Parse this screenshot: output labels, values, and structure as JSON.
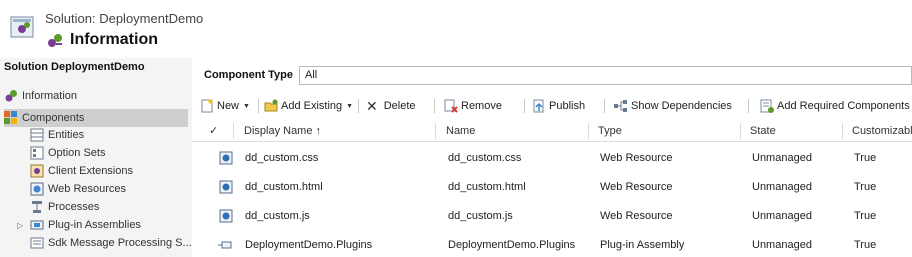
{
  "header": {
    "solution_label": "Solution: DeploymentDemo",
    "page_title": "Information"
  },
  "nav": {
    "title": "Solution DeploymentDemo",
    "items": [
      {
        "label": "Information",
        "icon": "information-icon"
      },
      {
        "label": "Components",
        "icon": "components-icon",
        "selected": true
      },
      {
        "label": "Entities",
        "icon": "entities-icon"
      },
      {
        "label": "Option Sets",
        "icon": "option-sets-icon"
      },
      {
        "label": "Client Extensions",
        "icon": "client-extensions-icon"
      },
      {
        "label": "Web Resources",
        "icon": "web-resources-icon"
      },
      {
        "label": "Processes",
        "icon": "processes-icon"
      },
      {
        "label": "Plug-in Assemblies",
        "icon": "plugin-assemblies-icon",
        "expander": "▷"
      },
      {
        "label": "Sdk Message Processing S...",
        "icon": "sdk-message-icon"
      }
    ]
  },
  "filter": {
    "label": "Component Type",
    "value": "All"
  },
  "toolbar": {
    "new": "New",
    "add_existing": "Add Existing",
    "delete": "Delete",
    "remove": "Remove",
    "publish": "Publish",
    "show_dependencies": "Show Dependencies",
    "add_required": "Add Required Components"
  },
  "grid": {
    "select_all_mark": "✓",
    "columns": [
      "Display Name ↑",
      "Name",
      "Type",
      "State",
      "Customizable"
    ],
    "rows": [
      {
        "display_name": "dd_custom.css",
        "name": "dd_custom.css",
        "type": "Web Resource",
        "state": "Unmanaged",
        "customizable": "True",
        "icon": "web-resource-icon"
      },
      {
        "display_name": "dd_custom.html",
        "name": "dd_custom.html",
        "type": "Web Resource",
        "state": "Unmanaged",
        "customizable": "True",
        "icon": "web-resource-icon"
      },
      {
        "display_name": "dd_custom.js",
        "name": "dd_custom.js",
        "type": "Web Resource",
        "state": "Unmanaged",
        "customizable": "True",
        "icon": "web-resource-icon"
      },
      {
        "display_name": "DeploymentDemo.Plugins",
        "name": "DeploymentDemo.Plugins",
        "type": "Plug-in Assembly",
        "state": "Unmanaged",
        "customizable": "True",
        "icon": "plugin-assembly-icon"
      }
    ]
  },
  "colors": {
    "nav_bg": "#f4f4f4",
    "nav_selected": "#cfcfcf",
    "accent_green": "#5a9b2a",
    "accent_purple": "#7a3d96"
  }
}
